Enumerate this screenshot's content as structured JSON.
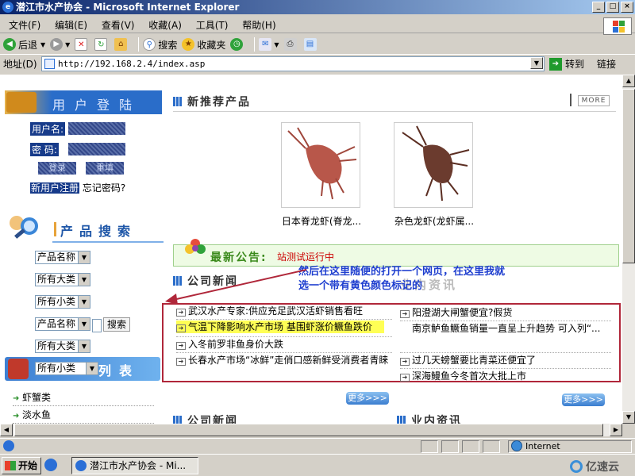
{
  "window": {
    "title": "潜江市水产协会 - Microsoft Internet Explorer",
    "buttons": [
      "_",
      "□",
      "×"
    ]
  },
  "menubar": {
    "items": [
      "文件(F)",
      "编辑(E)",
      "查看(V)",
      "收藏(A)",
      "工具(T)",
      "帮助(H)"
    ]
  },
  "toolbar": {
    "back": "后退",
    "search": "搜索",
    "favorites": "收藏夹"
  },
  "addressbar": {
    "label": "地址(D)",
    "url": "http://192.168.2.4/index.asp",
    "go": "转到",
    "links": "链接"
  },
  "sidebar": {
    "login_title": "用户登陆",
    "username_label": "用户名:",
    "password_label": "密  码:",
    "login_btn": "登录",
    "reset_btn": "重填",
    "register": "新用户注册",
    "forgot": "忘记密码?",
    "search_title": "产品搜索",
    "selects": [
      "产品名称",
      "所有大类",
      "所有小类",
      "产品名称",
      "所有大类",
      "所有小类"
    ],
    "search_btn": "搜索",
    "category_title": "列表",
    "categories": [
      "虾蟹类",
      "淡水鱼"
    ]
  },
  "main": {
    "new_products_title": "新推荐产品",
    "more": "MORE",
    "products": [
      {
        "name": "日本脊龙虾(脊龙..."
      },
      {
        "name": "杂色龙虾(龙虾属..."
      }
    ],
    "notice_title": "最新公告:",
    "notice_text": "站测试运行中",
    "company_news_title": "公司新闻",
    "industry_title": "业内资讯",
    "news_left": [
      "武汉水产专家:供应充足武汉活虾销售看旺",
      "气温下降影响水产市场 基围虾涨价鳜鱼跌价",
      "入冬前罗非鱼身价大跌",
      "长春水产市场“冰鲜”走俏口感新鲜受消费者青睐"
    ],
    "news_right": [
      "阳澄湖大闸蟹便宜?假货",
      "南京鲈鱼鳜鱼销量一直呈上升趋势 可入列“...",
      "过几天螃蟹要比青菜还便宜了",
      "深海鳗鱼今冬首次大批上市"
    ],
    "more_btn": "更多>>>",
    "annotation": "然后在这里随便的打开一个网页，在这里我就选一个带有黄色颜色标记的",
    "bottom_left_title": "公司新闻",
    "bottom_right_title": "业内资讯"
  },
  "statusbar": {
    "zone": "Internet"
  },
  "taskbar": {
    "start": "开始",
    "task": "潜江市水产协会 - Mi...",
    "watermark": "亿速云"
  },
  "colors": {
    "title_gradient_start": "#0a246a",
    "highlight": "#ffff55",
    "annotation": "#1f3fcf",
    "frame": "#b0273a"
  }
}
